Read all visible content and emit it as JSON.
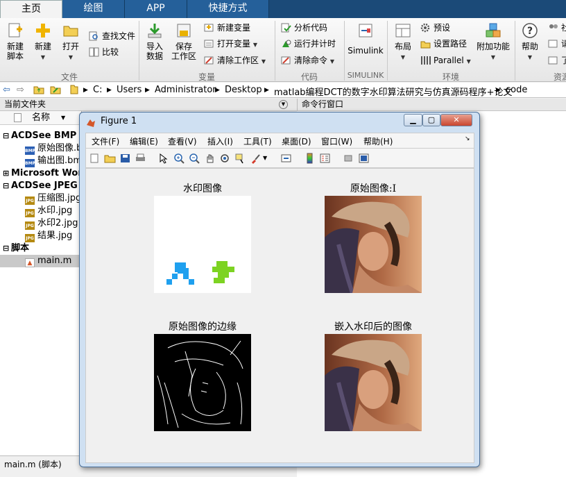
{
  "tabs": [
    "主页",
    "绘图",
    "APP",
    "快捷方式"
  ],
  "ribbon": {
    "file_group": {
      "new_script": "新建\n脚本",
      "new": "新建",
      "open": "打开",
      "find_files": "查找文件",
      "compare": "比较",
      "label": "文件"
    },
    "variable_group": {
      "import": "导入\n数据",
      "save_ws": "保存\n工作区",
      "new_var": "新建变量",
      "open_var": "打开变量",
      "clear_ws": "清除工作区",
      "label": "变量"
    },
    "code_group": {
      "analyze": "分析代码",
      "run_time": "运行并计时",
      "clear_cmds": "清除命令",
      "label": "代码"
    },
    "simulink_group": {
      "simulink": "Simulink",
      "label": "SIMULINK"
    },
    "env_group": {
      "layout": "布局",
      "prefs": "预设",
      "set_path": "设置路径",
      "parallel": "Parallel",
      "addons": "附加功能",
      "label": "环境"
    },
    "resources_group": {
      "help": "帮助",
      "comm": "社",
      "request": "请",
      "learn": "了",
      "label": "资源"
    }
  },
  "address": {
    "path": [
      "C:",
      "Users",
      "Administrator",
      "Desktop",
      "matlab编程DCT的数字水印算法研究与仿真源码程序+论文",
      "code"
    ]
  },
  "current_folder": {
    "title": "当前文件夹",
    "name_col": "名称",
    "items": [
      {
        "label": "ACDSee BMP 图",
        "type": "group"
      },
      {
        "label": "原始图像.bmp",
        "type": "bmp"
      },
      {
        "label": "输出图.bmp",
        "type": "bmp"
      },
      {
        "label": "Microsoft Word",
        "type": "group"
      },
      {
        "label": "ACDSee JPEG 图",
        "type": "group"
      },
      {
        "label": "压缩图.jpg",
        "type": "jpg"
      },
      {
        "label": "水印.jpg",
        "type": "jpg"
      },
      {
        "label": "水印2.jpg",
        "type": "jpg"
      },
      {
        "label": "结果.jpg",
        "type": "jpg"
      },
      {
        "label": "脚本",
        "type": "group"
      },
      {
        "label": "main.m",
        "type": "m"
      }
    ],
    "status": "main.m  (脚本)"
  },
  "command_window": {
    "title": "命令行窗口"
  },
  "figure": {
    "title": "Figure 1",
    "menu": [
      "文件(F)",
      "编辑(E)",
      "查看(V)",
      "插入(I)",
      "工具(T)",
      "桌面(D)",
      "窗口(W)",
      "帮助(H)"
    ],
    "plots": [
      {
        "title": "水印图像"
      },
      {
        "title": "原始图像:I"
      },
      {
        "title": "原始图像的边缘"
      },
      {
        "title": "嵌入水印后的图像"
      }
    ]
  },
  "colors": {
    "accent": "#1b4a78",
    "tab": "#25609a",
    "watermark_blue": "#1fa0ef",
    "watermark_green": "#7dd322"
  }
}
